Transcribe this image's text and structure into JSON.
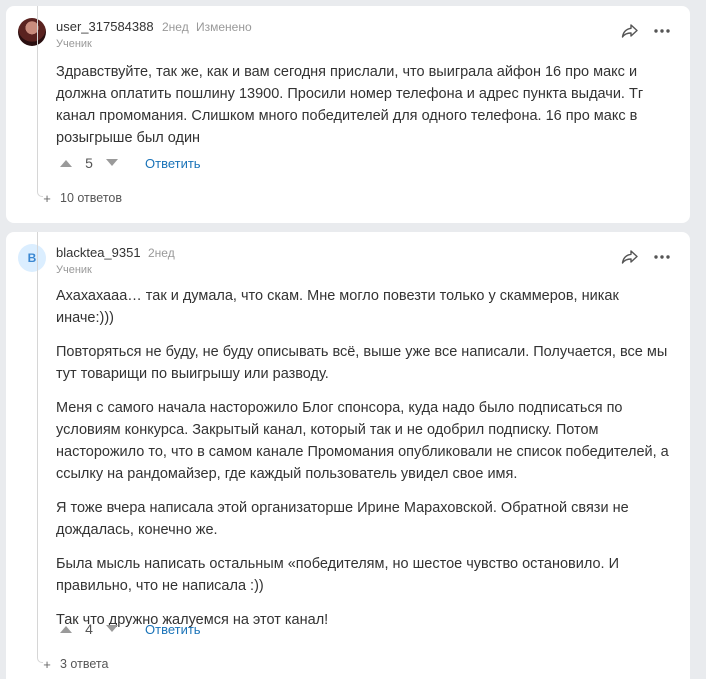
{
  "comments": [
    {
      "avatar": "user-photo",
      "username": "user_317584388",
      "time": "2нед",
      "edited": "Изменено",
      "role": "Ученик",
      "paragraphs": [
        "Здравствуйте, так же, как и вам сегодня прислали, что выиграла айфон 16 про макс и должна оплатить пошлину 13900. Просили номер телефона и адрес пункта выдачи. Тг канал промомания. Слишком много победителей для одного телефона. 16 про макс в розыгрыше был один"
      ],
      "votes": "5",
      "reply_label": "Ответить",
      "answers": "10 ответов"
    },
    {
      "avatar_letter": "B",
      "username": "blacktea_9351",
      "time": "2нед",
      "role": "Ученик",
      "paragraphs": [
        "Ахахахааа… так и думала, что скам. Мне могло повезти только у скаммеров, никак иначе:)))",
        "Повторяться не буду, не буду описывать всё, выше уже все написали. Получается, все мы тут товарищи по выигрышу или разводу.",
        "Меня с самого начала насторожило Блог спонсора, куда надо было подписаться по условиям конкурса. Закрытый канал, который так и не одобрил подписку. Потом насторожило то, что в самом канале Промомания опубликовали не список победителей, а ссылку на рандомайзер, где каждый пользователь увидел свое имя.",
        "Я тоже вчера написала этой организаторше Ирине Мараховской. Обратной связи не дождалась, конечно же.",
        "Была мысль написать остальным «победителям, но шестое чувство остановило. И правильно, что не написала :))",
        "Так что дружно жалуемся на этот канал!"
      ],
      "votes": "4",
      "reply_label": "Ответить",
      "answers": "3 ответа"
    }
  ],
  "icons": {
    "share": "share-icon",
    "more": "more-icon",
    "upvote": "upvote-icon",
    "downvote": "downvote-icon",
    "expand": "expand-plus-icon"
  },
  "colors": {
    "link": "#1a73b8",
    "background": "#e9ebee",
    "muted": "#999999"
  }
}
